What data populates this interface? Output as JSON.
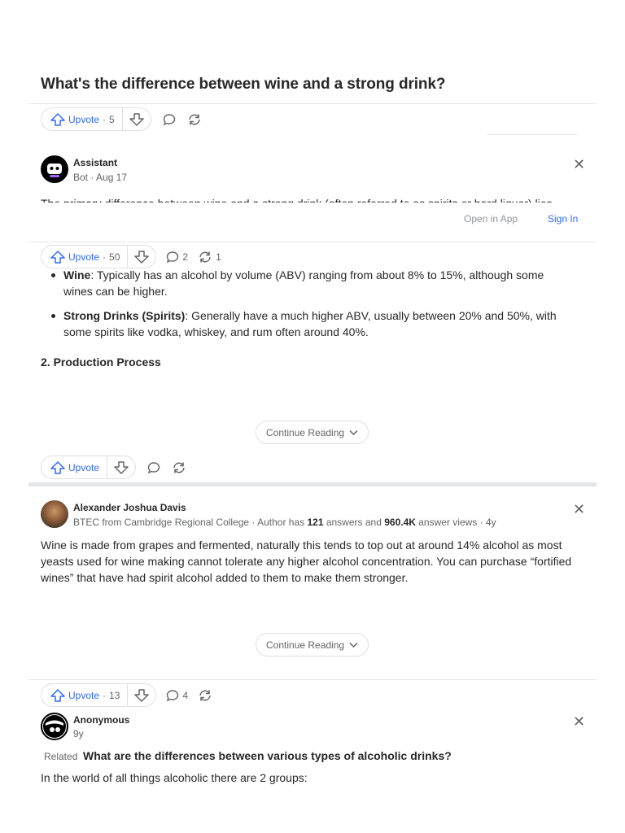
{
  "question": {
    "title": "What's the difference between wine and a strong drink?"
  },
  "question_actions": {
    "upvote_label": "Upvote",
    "upvote_count": "5"
  },
  "answer1": {
    "author": "Assistant",
    "meta": "Bot · Aug 17",
    "clipped_line": "The primary difference between wine and a strong drink (often referred to as spirits or hard liquor) lies",
    "open_in_app": "Open in App",
    "sign_in": "Sign In",
    "votes": {
      "upvote_label": "Upvote",
      "upvote_count": "50",
      "comments": "2",
      "shares": "1"
    },
    "bullet1_bold": "Wine",
    "bullet1_text": ": Typically has an alcohol by volume (ABV) ranging from about 8% to 15%, although some wines can be higher.",
    "bullet2_bold": "Strong Drinks (Spirits)",
    "bullet2_text": ": Generally have a much higher ABV, usually between 20% and 50%, with some spirits like vodka, whiskey, and rum often around 40%.",
    "section_heading": "2. Production Process",
    "continue_reading": "Continue Reading",
    "actions2": {
      "upvote_label": "Upvote"
    }
  },
  "answer2": {
    "author": "Alexander Joshua Davis",
    "meta_prefix": "BTEC from Cambridge Regional College · Author has ",
    "answers_count": "121",
    "meta_mid": " answers and ",
    "views_count": "960.4K",
    "meta_suffix": " answer views · 4y",
    "body": "Wine is made from grapes and fermented, naturally this tends to top out at around 14% alcohol as most yeasts used for wine making cannot tolerate any higher alcohol concentration. You can purchase “fortified wines” that have had spirit alcohol added to them to make them stronger.",
    "continue_reading": "Continue Reading",
    "votes": {
      "upvote_label": "Upvote",
      "upvote_count": "13",
      "comments": "4"
    }
  },
  "answer3": {
    "author": "Anonymous",
    "meta": "9y",
    "related_label": "Related",
    "related_question": "What are the differences between various types of alcoholic drinks?",
    "body": "In the world of all things alcoholic there are 2 groups:"
  },
  "icons": [
    "upvote-icon",
    "downvote-icon",
    "comment-icon",
    "share-icon",
    "close-icon",
    "chevron-down-icon"
  ],
  "colors": {
    "accent": "#2e69ff",
    "text": "#282829",
    "muted": "#636466",
    "divider": "#e6e7e8"
  }
}
